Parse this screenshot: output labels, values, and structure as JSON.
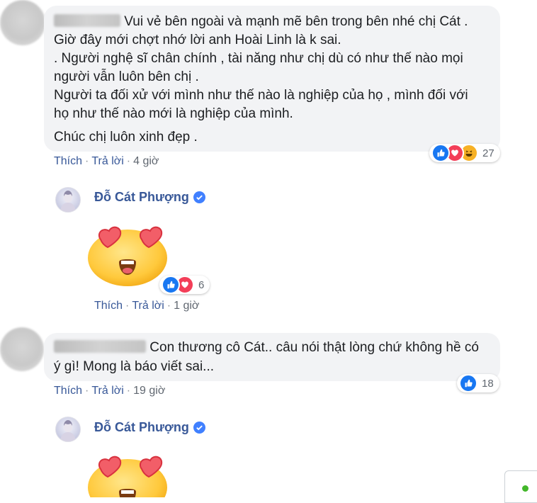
{
  "comments": [
    {
      "lines": [
        "Vui vẻ bên ngoài và mạnh mẽ bên trong bên nhé chị Cát .",
        "Giờ đây mới chợt nhớ lời anh Hoài Linh là k sai.",
        ". Người nghệ sĩ chân chính , tài năng như chị dù có như thế nào mọi",
        "người vẫn luôn bên chị .",
        "Người ta đối xử với mình như thế nào là nghiệp của họ , mình đối với",
        "họ như thế nào mới là nghiệp của mình.",
        "Chúc chị luôn xinh đẹp ."
      ],
      "actions": {
        "like": "Thích",
        "reply": "Trả lời",
        "time": "4 giờ"
      },
      "reaction_count": "27"
    },
    {
      "lines": [
        "Con thương cô Cát.. câu nói thật lòng chứ không hề có",
        "ý gì! Mong là báo viết sai..."
      ],
      "actions": {
        "like": "Thích",
        "reply": "Trả lời",
        "time": "19 giờ"
      },
      "reaction_count": "18"
    }
  ],
  "replies": [
    {
      "author": "Đỗ Cát Phượng",
      "sticker": "heart-eyes-emoji",
      "actions": {
        "like": "Thích",
        "reply": "Trả lời",
        "time": "1 giờ"
      },
      "reaction_count": "6"
    },
    {
      "author": "Đỗ Cát Phượng",
      "sticker": "heart-eyes-emoji"
    }
  ],
  "colors": {
    "bubble": "#f2f3f5",
    "link": "#385898",
    "meta": "#606770",
    "like": "#1877f2",
    "love": "#f33e58",
    "haha": "#f7b125"
  }
}
